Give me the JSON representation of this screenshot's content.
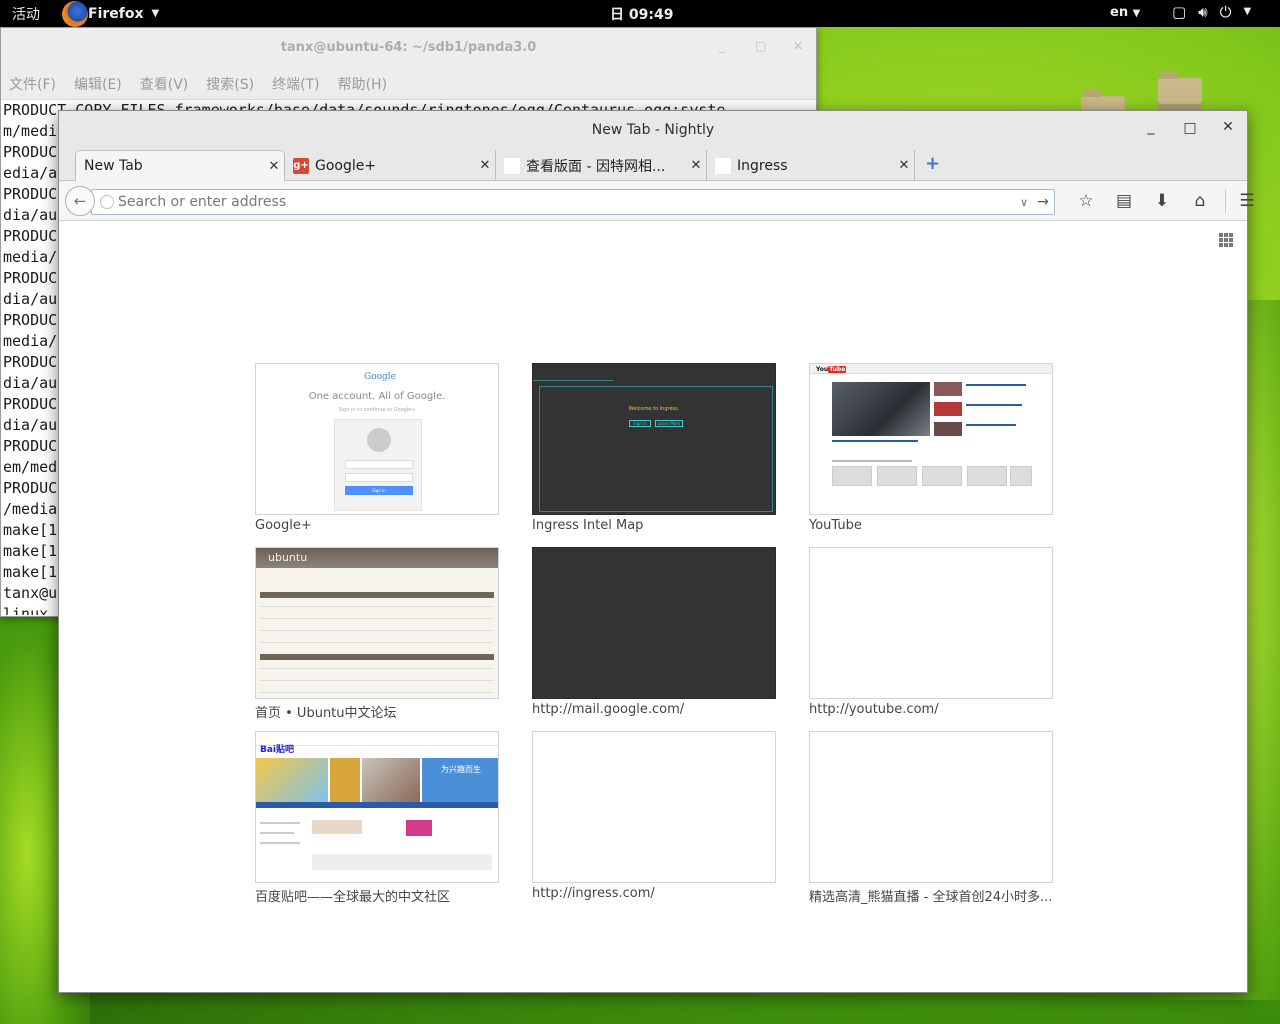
{
  "topbar": {
    "activities": "活动",
    "app_name": "Firefox",
    "clock": "日 09:49",
    "lang": "en"
  },
  "terminal": {
    "title": "tanx@ubuntu-64: ~/sdb1/panda3.0",
    "menu": [
      "文件(F)",
      "编辑(E)",
      "查看(V)",
      "搜索(S)",
      "终端(T)",
      "帮助(H)"
    ],
    "lines": [
      "PRODUCT_COPY_FILES frameworks/base/data/sounds/ringtones/ogg/Centaurus.ogg:syste",
      "m/medi",
      "PRODUC",
      "edia/a",
      "PRODUC",
      "dia/au",
      "PRODUC",
      "media/",
      "PRODUC",
      "dia/au",
      "PRODUC",
      "media/",
      "PRODUC",
      "dia/au",
      "PRODUC",
      "dia/au",
      "PRODUC",
      "em/med",
      "PRODUC",
      "/media",
      "make[1",
      "make[1",
      "make[1",
      "tanx@u",
      "linux"
    ]
  },
  "browser": {
    "title": "New Tab - Nightly",
    "tabs": [
      {
        "label": "New Tab",
        "favicon": ""
      },
      {
        "label": "Google+",
        "favicon": "g+"
      },
      {
        "label": "查看版面 - 因特网相...",
        "favicon": "ubuntu"
      },
      {
        "label": "Ingress",
        "favicon": "ingress"
      }
    ],
    "address_placeholder": "Search or enter address",
    "tiles": [
      {
        "label": "Google+",
        "kind": "google"
      },
      {
        "label": "Ingress Intel Map",
        "kind": "ingress"
      },
      {
        "label": "YouTube",
        "kind": "youtube"
      },
      {
        "label": "首页 • Ubuntu中文论坛",
        "kind": "ubuntu"
      },
      {
        "label": "http://mail.google.com/",
        "kind": "dark"
      },
      {
        "label": "http://youtube.com/",
        "kind": "blank"
      },
      {
        "label": "百度贴吧——全球最大的中文社区",
        "kind": "baidu"
      },
      {
        "label": "http://ingress.com/",
        "kind": "blank"
      },
      {
        "label": "精选高清_熊猫直播 - 全球首创24小时多...",
        "kind": "blank"
      }
    ],
    "thumb_text": {
      "google_logo": "Google",
      "google_tagline": "One account. All of Google.",
      "google_sub": "Sign in to continue to Google+",
      "google_signin": "Sign in",
      "ingress_welcome": "Welcome to Ingress.",
      "ingress_signin": "Sign in",
      "ingress_learn": "Learn More",
      "youtube_logo_you": "You",
      "youtube_logo_tube": "Tube",
      "ubuntu_logo": "ubuntu",
      "baidu_logo": "Bai",
      "baidu_logo2": "贴吧",
      "baidu_banner": "为兴趣而生"
    }
  }
}
